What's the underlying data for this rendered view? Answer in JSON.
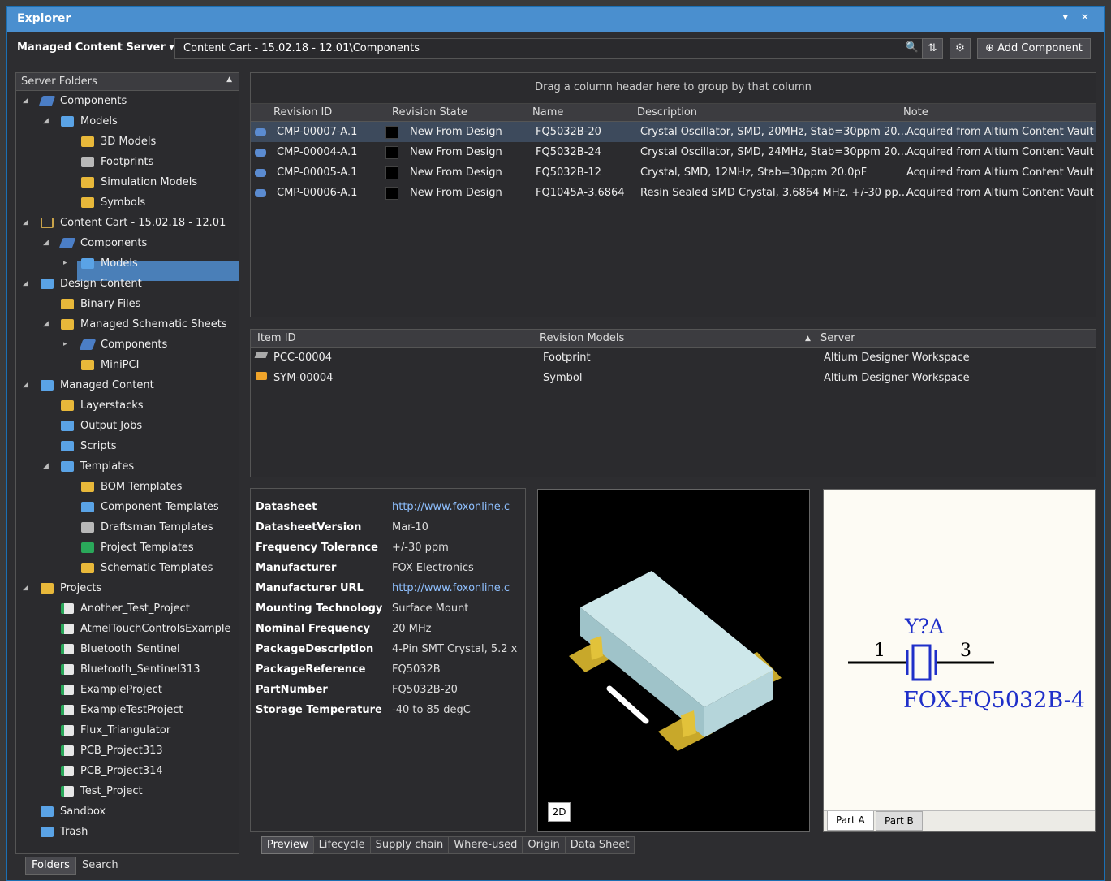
{
  "window": {
    "title": "Explorer",
    "controls": "▾ ✕"
  },
  "toolbar": {
    "server": "Managed Content Server ▾",
    "path": "Content Cart - 15.02.18 - 12.01\\Components",
    "add_component": "Add Component"
  },
  "tree": {
    "header": "Server Folders",
    "nodes": [
      "Components",
      "Models",
      "3D Models",
      "Footprints",
      "Simulation Models",
      "Symbols",
      "Content Cart - 15.02.18 - 12.01",
      "Components",
      "Models",
      "Design Content",
      "Binary Files",
      "Managed Schematic Sheets",
      "Components",
      "MiniPCI",
      "Managed Content",
      "Layerstacks",
      "Output Jobs",
      "Scripts",
      "Templates",
      "BOM Templates",
      "Component Templates",
      "Draftsman Templates",
      "Project Templates",
      "Schematic Templates",
      "Projects",
      "Another_Test_Project",
      "AtmelTouchControlsExample",
      "Bluetooth_Sentinel",
      "Bluetooth_Sentinel313",
      "ExampleProject",
      "ExampleTestProject",
      "Flux_Triangulator",
      "PCB_Project313",
      "PCB_Project314",
      "Test_Project",
      "Sandbox",
      "Trash"
    ]
  },
  "left_tabs": [
    "Folders",
    "Search"
  ],
  "components": {
    "group_hint": "Drag a column header here to group by that column",
    "headers": [
      "Revision ID",
      "Revision State",
      "Name",
      "Description",
      "Note"
    ],
    "rows": [
      [
        "CMP-00007-A.1",
        "New From Design",
        "FQ5032B-20",
        "Crystal Oscillator, SMD, 20MHz, Stab=30ppm 20...",
        "Acquired from Altium Content Vault"
      ],
      [
        "CMP-00004-A.1",
        "New From Design",
        "FQ5032B-24",
        "Crystal Oscillator, SMD, 24MHz, Stab=30ppm 20...",
        "Acquired from Altium Content Vault"
      ],
      [
        "CMP-00005-A.1",
        "New From Design",
        "FQ5032B-12",
        "Crystal, SMD, 12MHz, Stab=30ppm 20.0pF",
        "Acquired from Altium Content Vault"
      ],
      [
        "CMP-00006-A.1",
        "New From Design",
        "FQ1045A-3.6864",
        "Resin Sealed SMD Crystal, 3.6864 MHz, +/-30 pp...",
        "Acquired from Altium Content Vault"
      ]
    ]
  },
  "models": {
    "headers": [
      "Item ID",
      "Revision Models",
      "Server"
    ],
    "rows": [
      [
        "PCC-00004",
        "Footprint",
        "Altium Designer Workspace"
      ],
      [
        "SYM-00004",
        "Symbol",
        "Altium Designer Workspace"
      ]
    ]
  },
  "params": [
    [
      "Datasheet",
      "http://www.foxonline.c"
    ],
    [
      "DatasheetVersion",
      "Mar-10"
    ],
    [
      "Frequency Tolerance",
      "+/-30 ppm"
    ],
    [
      "Manufacturer",
      "FOX Electronics"
    ],
    [
      "Manufacturer URL",
      "http://www.foxonline.c"
    ],
    [
      "Mounting Technology",
      "Surface Mount"
    ],
    [
      "Nominal Frequency",
      "20 MHz"
    ],
    [
      "PackageDescription",
      "4-Pin SMT Crystal, 5.2 x"
    ],
    [
      "PackageReference",
      "FQ5032B"
    ],
    [
      "PartNumber",
      "FQ5032B-20"
    ],
    [
      "Storage Temperature",
      "-40 to 85 degC"
    ]
  ],
  "view3d": {
    "btn": "2D"
  },
  "symbol": {
    "designator": "Y?A",
    "pin1": "1",
    "pin3": "3",
    "comment": "FOX-FQ5032B-4",
    "tab_a": "Part A",
    "tab_b": "Part B"
  },
  "bottom_tabs": [
    "Preview",
    "Lifecycle",
    "Supply chain",
    "Where-used",
    "Origin",
    "Data Sheet"
  ]
}
